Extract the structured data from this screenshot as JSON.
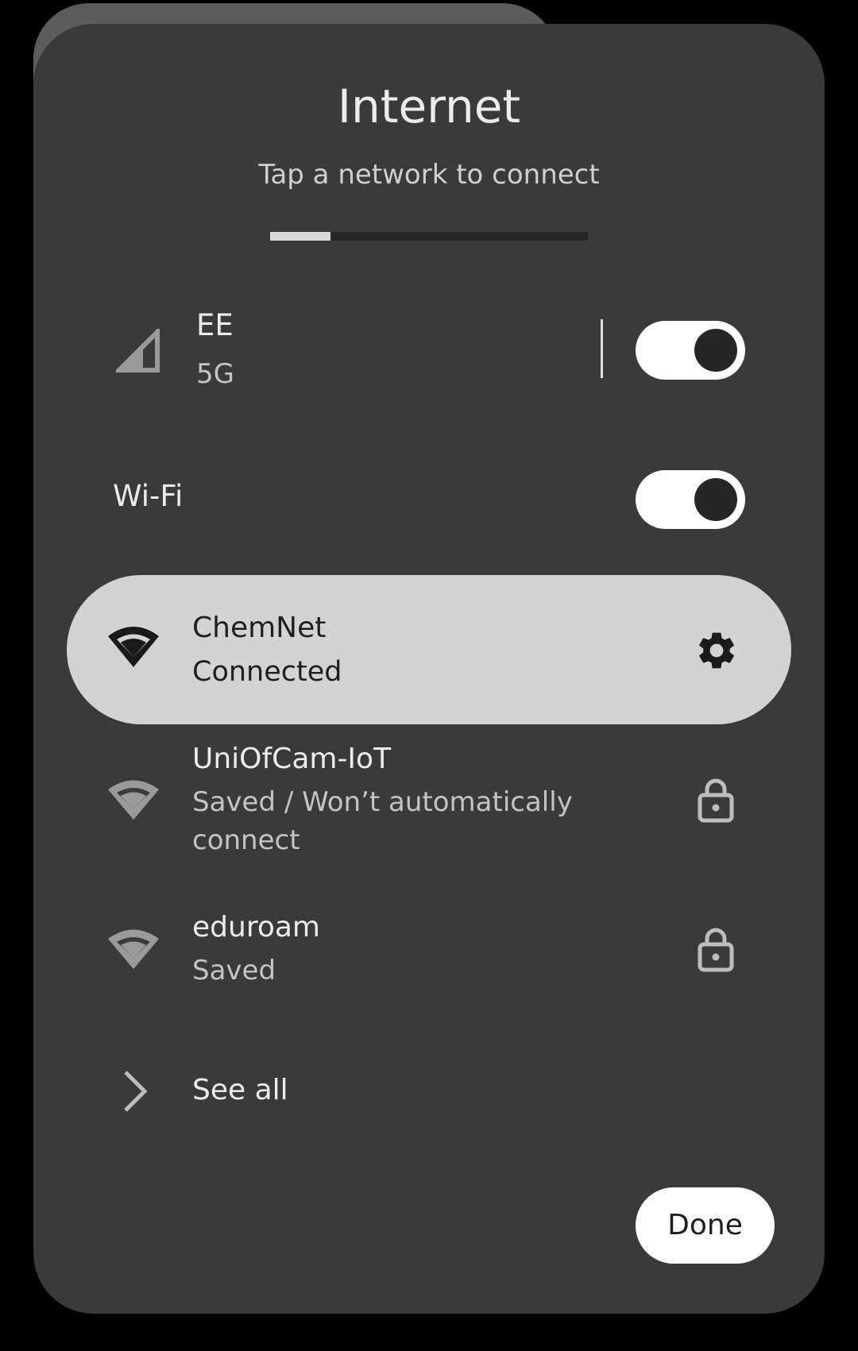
{
  "dialog": {
    "title": "Internet",
    "subtitle": "Tap a network to connect",
    "progress_fraction": 0.19
  },
  "mobile": {
    "carrier": "EE",
    "network_type": "5G",
    "enabled": true
  },
  "wifi": {
    "label": "Wi-Fi",
    "enabled": true
  },
  "networks": [
    {
      "name": "ChemNet",
      "status": "Connected",
      "action_icon": "gear-icon",
      "active": true
    },
    {
      "name": "UniOfCam-IoT",
      "status_line1": "Saved / Won’t automatically",
      "status_line2": "connect",
      "action_icon": "lock-icon",
      "active": false
    },
    {
      "name": "eduroam",
      "status": "Saved",
      "action_icon": "lock-icon",
      "active": false
    }
  ],
  "see_all": {
    "label": "See all"
  },
  "done_button": {
    "label": "Done"
  },
  "colors": {
    "background": "#000000",
    "panel": "#3a3a3a",
    "active_row": "#d3d3d3",
    "toggle_track": "#ffffff",
    "toggle_knob": "#262626"
  }
}
